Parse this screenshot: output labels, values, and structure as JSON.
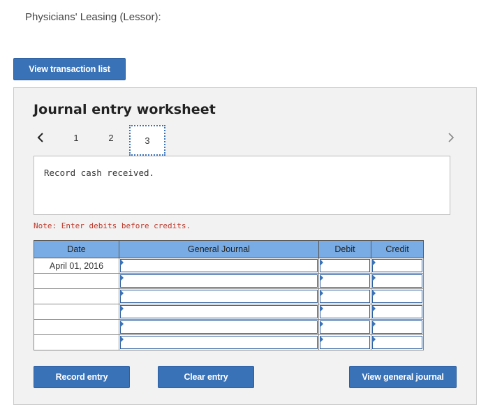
{
  "heading": "Physicians' Leasing (Lessor):",
  "buttons": {
    "view_transaction_list": "View transaction list",
    "record_entry": "Record entry",
    "clear_entry": "Clear entry",
    "view_general_journal": "View general journal"
  },
  "worksheet": {
    "title": "Journal entry worksheet",
    "tabs": [
      "1",
      "2",
      "3"
    ],
    "active_tab": "3",
    "description": "Record cash received.",
    "note": "Note: Enter debits before credits."
  },
  "journal": {
    "columns": [
      "Date",
      "General Journal",
      "Debit",
      "Credit"
    ],
    "rows": [
      {
        "date": "April 01, 2016"
      },
      {
        "date": ""
      },
      {
        "date": ""
      },
      {
        "date": ""
      },
      {
        "date": ""
      },
      {
        "date": ""
      }
    ]
  },
  "colors": {
    "accent": "#3a72b8",
    "header": "#79ace4",
    "note": "#c0392b"
  },
  "icons": {
    "prev": "chevron-left-icon",
    "next": "chevron-right-icon"
  }
}
